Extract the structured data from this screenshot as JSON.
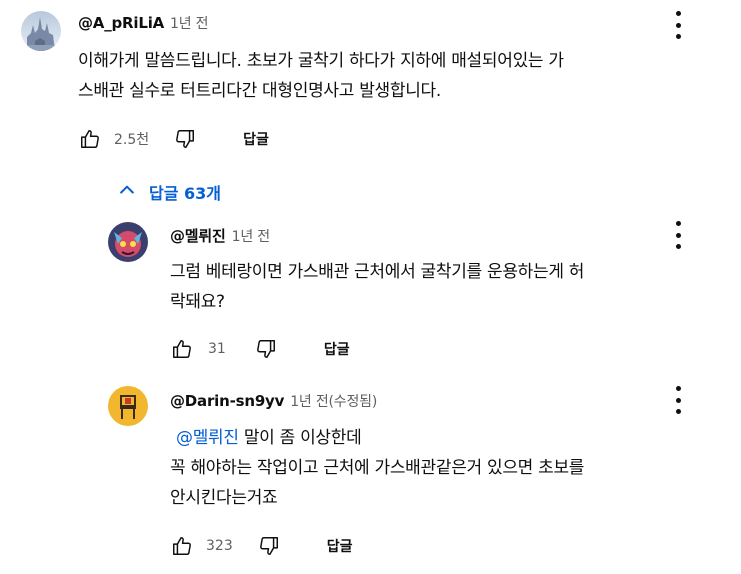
{
  "comment": {
    "author": "@A_pRiLiA",
    "time": "1년 전",
    "text_line1": "이해가게 말씀드립니다. 초보가 굴착기 하다가 지하에 매설되어있는 가",
    "text_line2": "스배관 실수로 터트리다간 대형인명사고 발생합니다.",
    "likes": "2.5천",
    "reply_label": "답글"
  },
  "replies_toggle": {
    "label": "답글 63개"
  },
  "replies": [
    {
      "author": "@멜뤼진",
      "time": "1년 전",
      "text_line1": "그럼 베테랑이면 가스배관 근처에서 굴착기를 운용하는게 허",
      "text_line2": "락돼요?",
      "likes": "31",
      "reply_label": "답글"
    },
    {
      "author": "@Darin-sn9yv",
      "time": "1년 전(수정됨)",
      "mention": "@멜뤼진",
      "text_line1_rest": " 말이 좀 이상한데",
      "text_line2": "꼭 해야하는 작업이고 근처에 가스배관같은거 있으면 초보를",
      "text_line3": "안시킨다는거죠",
      "likes": "323",
      "reply_label": "답글"
    }
  ],
  "colors": {
    "link": "#065fd4",
    "secondary_text": "#606060",
    "primary_text": "#0f0f0f"
  }
}
